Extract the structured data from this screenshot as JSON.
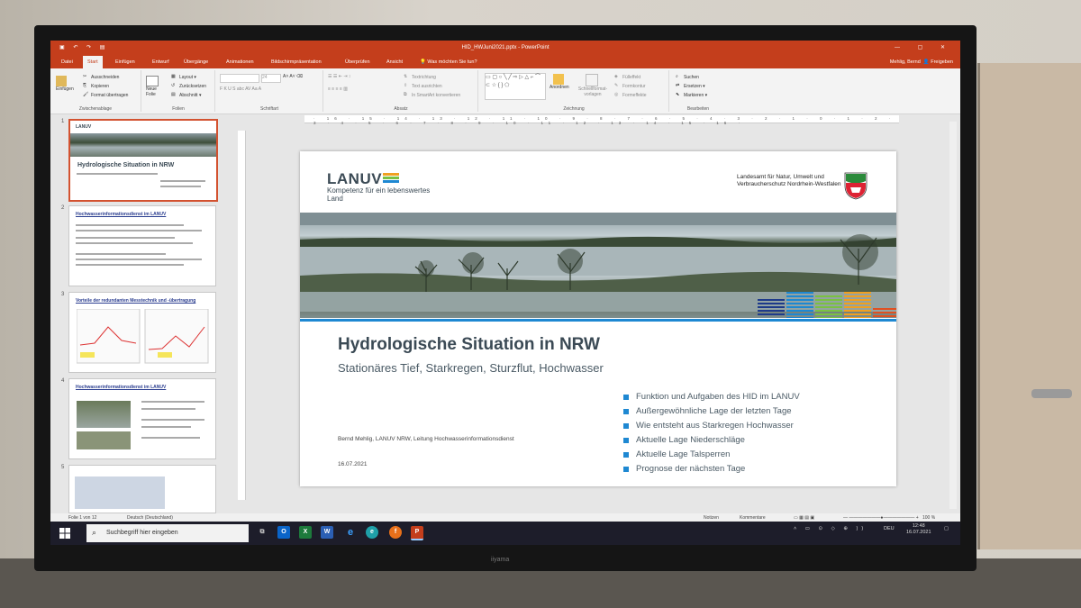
{
  "window": {
    "doc_title": "HID_HWJuni2021.pptx  -  PowerPoint",
    "user": "Mehlig, Bernd",
    "share": "Freigeben",
    "tell_me": "Was möchten Sie tun?"
  },
  "ribbon_tabs": [
    "Datei",
    "Start",
    "Einfügen",
    "Entwurf",
    "Übergänge",
    "Animationen",
    "Bildschirmpräsentation",
    "Überprüfen",
    "Ansicht"
  ],
  "ribbon": {
    "clipboard": {
      "paste": "Einfügen",
      "cut": "Ausschneiden",
      "copy": "Kopieren",
      "format": "Format übertragen",
      "label": "Zwischenablage"
    },
    "slides": {
      "new": "Neue Folie",
      "layout": "Layout",
      "reset": "Zurücksetzen",
      "section": "Abschnitt",
      "label": "Folien"
    },
    "font": {
      "size": "24",
      "label": "Schriftart"
    },
    "paragraph": {
      "direction": "Textrichtung",
      "align": "Text ausrichten",
      "smartart": "In SmartArt konvertieren",
      "label": "Absatz"
    },
    "drawing": {
      "arrange": "Anordnen",
      "quick": "Schnellformat-vorlagen",
      "fill": "Fülleffekt",
      "outline": "Formkontur",
      "effects": "Formeffekte",
      "label": "Zeichnung"
    },
    "editing": {
      "find": "Suchen",
      "replace": "Ersetzen",
      "select": "Markieren",
      "label": "Bearbeiten"
    }
  },
  "thumbnails": [
    {
      "num": "1",
      "title": "Hydrologische Situation in NRW"
    },
    {
      "num": "2",
      "title": "Hochwasserinformationsdienst im LANUV"
    },
    {
      "num": "3",
      "title": "Vorteile der redundanten Messtechnik und -übertragung"
    },
    {
      "num": "4",
      "title": "Hochwasserinformationsdienst im LANUV"
    },
    {
      "num": "5",
      "title": ""
    }
  ],
  "slide": {
    "logo": "LANUV",
    "logo_sub": "Kompetenz für ein lebenswertes Land",
    "ministry": "Landesamt für Natur, Umwelt und Verbraucherschutz Nordrhein-Westfalen",
    "title": "Hydrologische Situation in NRW",
    "subtitle": "Stationäres Tief, Starkregen, Sturzflut, Hochwasser",
    "bullets": [
      "Funktion und Aufgaben des HID im LANUV",
      "Außergewöhnliche Lage der letzten Tage",
      "Wie entsteht aus Starkregen Hochwasser",
      "Aktuelle Lage Niederschläge",
      "Aktuelle Lage Talsperren",
      "Prognose der nächsten Tage"
    ],
    "author": "Bernd Mehlig, LANUV NRW, Leitung Hochwasserinformationsdienst",
    "date": "16.07.2021",
    "colors": {
      "accent": "#1e88d2",
      "title": "#3b4a55"
    }
  },
  "status": {
    "slide": "Folie 1 von 12",
    "lang": "Deutsch (Deutschland)",
    "notes": "Notizen",
    "comments": "Kommentare",
    "zoom": "100 %"
  },
  "taskbar": {
    "search": "Suchbegriff hier eingeben",
    "lang": "DEU",
    "time": "12:48",
    "date": "16.07.2021"
  },
  "monitor_brand": "iiyama"
}
